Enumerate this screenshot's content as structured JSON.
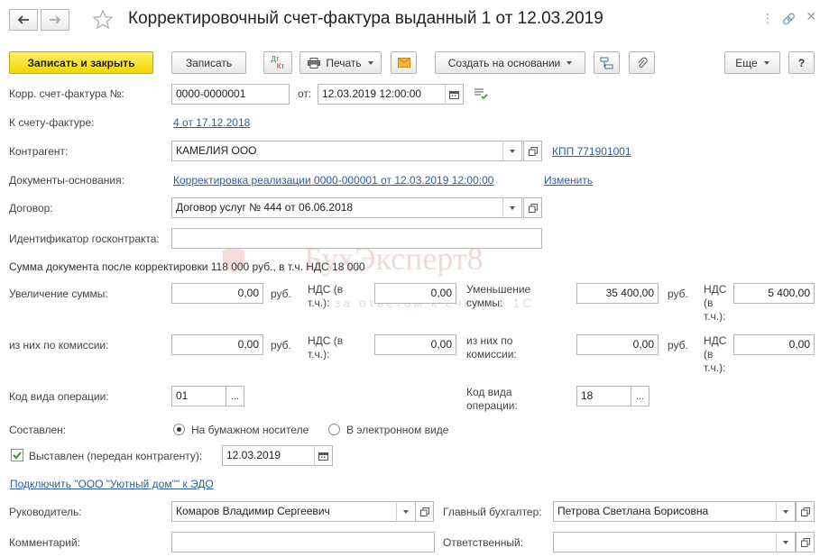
{
  "window": {
    "title": "Корректировочный счет-фактура выданный 1 от 12.03.2019",
    "more_icon": "⋮",
    "link_icon": "🔗",
    "close_icon": "×"
  },
  "toolbar": {
    "save_close": "Записать и закрыть",
    "save": "Записать",
    "dtkt_top": "Дт",
    "dtkt_bottom": "Кт",
    "print": "Печать",
    "create_based": "Создать на основании",
    "more": "Еще",
    "help": "?"
  },
  "form": {
    "corr_invoice_label": "Корр. счет-фактура №:",
    "corr_invoice_number": "0000-0000001",
    "date_label": "от:",
    "date_value": "12.03.2019 12:00:00",
    "to_invoice_label": "К счету-фактуре:",
    "to_invoice_link": "4 от 17.12.2018",
    "counterparty_label": "Контрагент:",
    "counterparty_value": "КАМЕЛИЯ ООО",
    "kpp_link": "КПП 771901001",
    "base_docs_label": "Документы-основания:",
    "base_docs_link": "Корректировка реализации 0000-000001 от 12.03.2019 12:00:00",
    "change_link": "Изменить",
    "contract_label": "Договор:",
    "contract_value": "Договор услуг № 444 от 06.06.2018",
    "gov_contract_label": "Идентификатор госконтракта:",
    "gov_contract_value": "",
    "doc_sum_text": "Сумма документа после корректировки 118 000 руб., в т.ч. НДС 18 000",
    "increase_label": "Увеличение суммы:",
    "increase_value": "0,00",
    "rub": "руб.",
    "vat_label": "НДС (в т.ч.):",
    "increase_vat_value": "0,00",
    "decrease_label": "Уменьшение суммы:",
    "decrease_value": "35 400,00",
    "decrease_vat_value": "5 400,00",
    "commission_label": "из них по комиссии:",
    "commission_inc_value": "0,00",
    "commission_inc_vat_value": "0,00",
    "commission_dec_value": "0,00",
    "commission_dec_vat_value": "0,00",
    "op_code_label_left": "Код вида операции:",
    "op_code_left_value": "01",
    "op_code_label_right": "Код вида операции:",
    "op_code_right_value": "18",
    "ellipsis": "...",
    "compiled_label": "Составлен:",
    "paper_option": "На бумажном носителе",
    "electronic_option": "В электронном виде",
    "issued_label": "Выставлен (передан контрагенту):",
    "issued_date": "12.03.2019",
    "edo_link": "Подключить \"ООО \"Уютный дом\"\" к ЭДО",
    "head_label": "Руководитель:",
    "head_value": "Комаров Владимир Сергеевич",
    "chief_acc_label": "Главный бухгалтер:",
    "chief_acc_value": "Петрова Светлана Борисовна",
    "comment_label": "Комментарий:",
    "comment_value": "",
    "responsible_label": "Ответственный:",
    "responsible_value": ""
  },
  "watermark": {
    "brand": "БухЭксперт8",
    "tagline": "за ответом к счету в 1С"
  }
}
